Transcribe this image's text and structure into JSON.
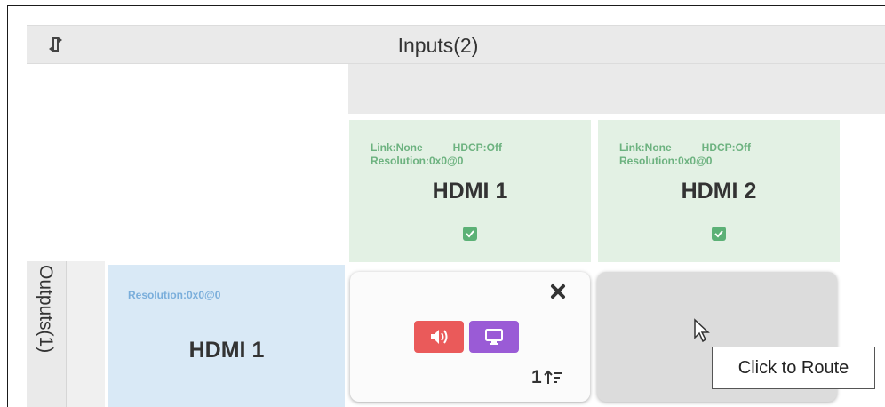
{
  "header": {
    "title": "Inputs(2)",
    "refresh_icon": "refresh-icon"
  },
  "inputs": [
    {
      "link": "Link:None",
      "hdcp": "HDCP:Off",
      "resolution": "Resolution:0x0@0",
      "name": "HDMI 1",
      "selected": true,
      "color": "#e3f1e4"
    },
    {
      "link": "Link:None",
      "hdcp": "HDCP:Off",
      "resolution": "Resolution:0x0@0",
      "name": "HDMI 2",
      "selected": true,
      "color": "#e3f1e4"
    }
  ],
  "outputs": {
    "label": "Outputs(1)",
    "items": [
      {
        "resolution": "Resolution:0x0@0",
        "name": "HDMI 1",
        "color": "#d9e9f6"
      }
    ]
  },
  "routes": [
    {
      "input": "HDMI 1",
      "output": "HDMI 1",
      "audio_color": "#ea5a5a",
      "video_color": "#9a5bd6",
      "priority": "1",
      "icons": [
        "speaker-icon",
        "monitor-icon",
        "close-icon",
        "sort-priority-icon"
      ]
    }
  ],
  "tooltip": {
    "text": "Click to Route"
  }
}
